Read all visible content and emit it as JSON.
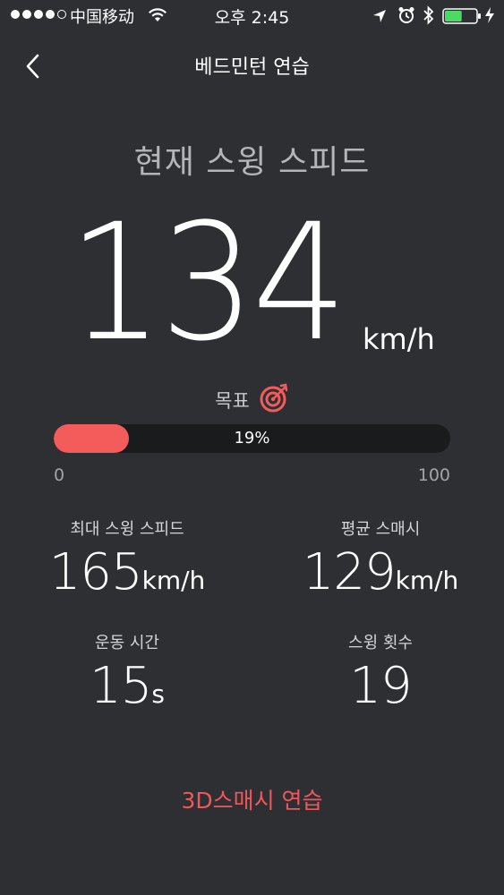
{
  "status_bar": {
    "carrier": "中国移动",
    "time": "오후 2:45",
    "signal_filled": 4,
    "signal_total": 5,
    "battery_level": 0.55,
    "battery_color": "#4cd964"
  },
  "nav": {
    "title": "베드민턴 연습",
    "back_icon": "chevron-left-icon"
  },
  "current": {
    "label": "현재 스윙 스피드",
    "speed": "134",
    "unit": "km/h"
  },
  "goal": {
    "label": "목표",
    "icon": "target-icon",
    "progress": 0.19,
    "progress_text": "19%",
    "min": "0",
    "max": "100"
  },
  "stats": {
    "max_speed": {
      "label": "최대 스윙 스피드",
      "value": "165",
      "unit": "km/h"
    },
    "avg_smash": {
      "label": "평균 스매시",
      "value": "129",
      "unit": "km/h"
    },
    "exercise_time": {
      "label": "운동 시간",
      "value": "15",
      "unit": "s"
    },
    "swing_count": {
      "label": "스윙 횟수",
      "value": "19",
      "unit": ""
    }
  },
  "action": {
    "practice_3d": "3D스매시 연습"
  },
  "colors": {
    "background": "#2d2f33",
    "accent": "#f45b5b",
    "track": "#1a1b1d"
  }
}
